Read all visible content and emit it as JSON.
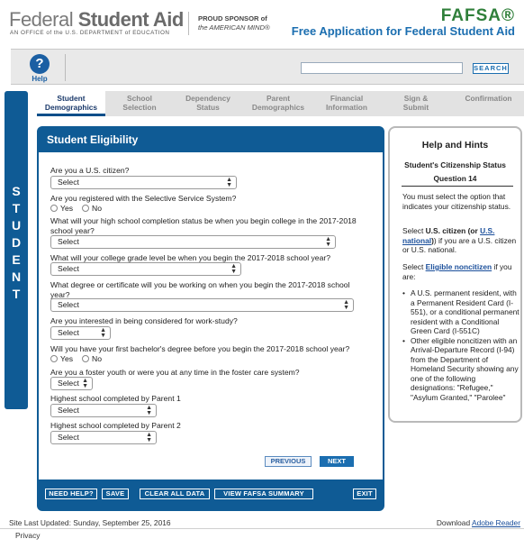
{
  "header": {
    "logo_light": "Federal",
    "logo_bold": "Student Aid",
    "tagline": "AN OFFICE of the U.S. DEPARTMENT of EDUCATION",
    "sponsor_line1": "PROUD SPONSOR of",
    "sponsor_line2": "the AMERICAN MIND®",
    "fafsa_mark": "FAFSA®",
    "fafsa_subtitle": "Free Application for Federal Student Aid"
  },
  "toolbar": {
    "help_label": "Help",
    "help_icon": "question-icon",
    "search_value": "",
    "search_button": "SEARCH"
  },
  "steps": [
    {
      "label": "Student\nDemographics",
      "active": true
    },
    {
      "label": "School\nSelection",
      "active": false
    },
    {
      "label": "Dependency\nStatus",
      "active": false
    },
    {
      "label": "Parent\nDemographics",
      "active": false
    },
    {
      "label": "Financial\nInformation",
      "active": false
    },
    {
      "label": "Sign &\nSubmit",
      "active": false
    },
    {
      "label": "Confirmation",
      "active": false
    }
  ],
  "rail_letters": [
    "S",
    "T",
    "U",
    "D",
    "E",
    "N",
    "T"
  ],
  "panel": {
    "title": "Student Eligibility",
    "questions": {
      "citizen": {
        "label": "Are you a U.S. citizen?",
        "value": "Select"
      },
      "selective_service": {
        "label": "Are you registered with the Selective Service System?",
        "yes": "Yes",
        "no": "No"
      },
      "high_school": {
        "label": "What will your high school completion status be when you begin college in the 2017-2018 school year?",
        "value": "Select"
      },
      "grade_level": {
        "label": "What will your college grade level be when you begin the 2017-2018 school year?",
        "value": "Select"
      },
      "degree": {
        "label": "What degree or certificate will you be working on when you begin the 2017-2018 school year?",
        "value": "Select"
      },
      "work_study": {
        "label": "Are you interested in being considered for work-study?",
        "value": "Select"
      },
      "first_bachelor": {
        "label": "Will you have your first bachelor's degree before you begin the 2017-2018 school year?",
        "yes": "Yes",
        "no": "No"
      },
      "foster": {
        "label": "Are you a foster youth or were you at any time in the foster care system?",
        "value": "Select"
      },
      "parent1": {
        "label": "Highest school completed by Parent 1",
        "value": "Select"
      },
      "parent2": {
        "label": "Highest school completed by Parent 2",
        "value": "Select"
      }
    },
    "previous": "PREVIOUS",
    "next": "NEXT",
    "bottom": {
      "need_help": "NEED HELP?",
      "save": "SAVE",
      "clear_all": "CLEAR ALL DATA",
      "view_summary": "VIEW FAFSA SUMMARY",
      "exit": "EXIT"
    }
  },
  "hints": {
    "title": "Help and Hints",
    "subtitle": "Student's Citizenship Status",
    "question_no": "Question 14",
    "p1": "You must select the option that indicates your citizenship status.",
    "p2_prefix": "Select ",
    "p2_bold": "U.S. citizen (or ",
    "p2_link": "U.S. national",
    "p2_suffix": ") if you are a U.S. citizen or U.S. national.",
    "p3_prefix": "Select ",
    "p3_link": "Eligible noncitizen",
    "p3_suffix": " if you are:",
    "list": [
      "A U.S. permanent resident, with a Permanent Resident Card (I-551), or a conditional permanent resident with a Conditional Green Card (I-551C)",
      "Other eligible noncitizen with an Arrival-Departure Record (I-94) from the Department of Homeland Security showing any one of the following designations: \"Refugee,\" \"Asylum Granted,\" \"Parolee\""
    ]
  },
  "footer": {
    "updated": "Site Last Updated: Sunday, September 25, 2016",
    "download_prefix": "Download ",
    "download_link": "Adobe Reader",
    "privacy": "Privacy"
  }
}
